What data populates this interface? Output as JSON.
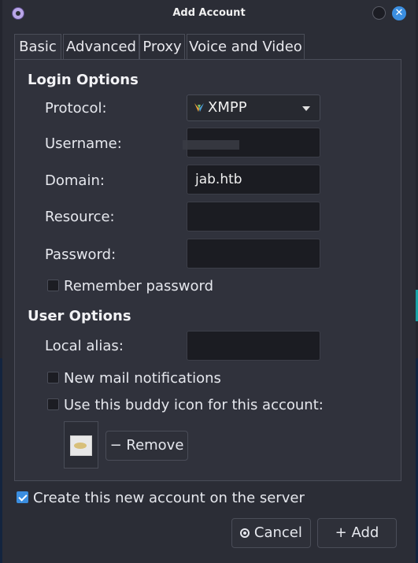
{
  "window": {
    "title": "Add Account"
  },
  "tabs": [
    {
      "label": "Basic"
    },
    {
      "label": "Advanced"
    },
    {
      "label": "Proxy"
    },
    {
      "label": "Voice and Video"
    }
  ],
  "login_options": {
    "heading": "Login Options",
    "protocol_label": "Protocol:",
    "protocol_value": "XMPP",
    "username_label": "Username:",
    "username_value": "",
    "domain_label": "Domain:",
    "domain_value": "jab.htb",
    "resource_label": "Resource:",
    "resource_value": "",
    "password_label": "Password:",
    "password_value": "",
    "remember_password_label": "Remember password",
    "remember_password_checked": false
  },
  "user_options": {
    "heading": "User Options",
    "local_alias_label": "Local alias:",
    "local_alias_value": "",
    "new_mail_label": "New mail notifications",
    "new_mail_checked": false,
    "buddy_icon_label": "Use this buddy icon for this account:",
    "buddy_icon_checked": false,
    "remove_button": "− Remove"
  },
  "create_account": {
    "label": "Create this new account on the server",
    "checked": true
  },
  "buttons": {
    "cancel": "Cancel",
    "add": "+ Add"
  },
  "colors": {
    "accent": "#3b8ee0",
    "window_bg": "#2b2d36",
    "entry_bg": "#1b1c22"
  }
}
